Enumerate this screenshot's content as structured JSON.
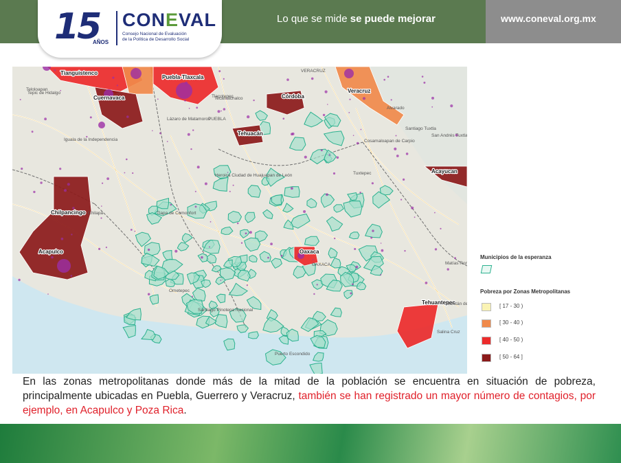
{
  "header": {
    "tagline_prefix": "Lo que se mide ",
    "tagline_bold": "se puede mejorar",
    "url": "www.coneval.org.mx",
    "colors": {
      "bar": "#5b7a50",
      "url_bar": "#8d8d8d"
    }
  },
  "logo": {
    "anniversary": "15",
    "anniversary_suffix": "AÑOS",
    "name_part1": "CON",
    "name_accent": "E",
    "name_part2": "VAL",
    "subtitle_line1": "Consejo Nacional de Evaluación",
    "subtitle_line2": "de la Política de Desarrollo Social"
  },
  "map": {
    "labels": [
      "Tianguistenco",
      "Puebla-Tlaxcala",
      "Veracruz",
      "Cuernavaca",
      "Tehuacán",
      "Córdoba",
      "Tlacotepec",
      "Teloloapan",
      "Chilpancingo",
      "Acapulco",
      "Oaxaca",
      "OAXACA",
      "Tehuantepec",
      "Acayucan",
      "Alvarado",
      "Santiago Tuxtla",
      "Cosamaloapan de Carpio",
      "San Andrés Tuxtla",
      "Iguala de la Independencia",
      "Heroica Ciudad de Huajuapan de León",
      "Tlapa de Comonfort",
      "Ometepec",
      "Santiago Pinotepa Nacional",
      "Puerto Escondido",
      "Juchitán de Zaragoza",
      "Salina Cruz",
      "Matías Romero",
      "Tuxtepec",
      "PUEBLA",
      "VERACRUZ",
      "Tepic de Hidalgo",
      "Lázaro de Matamoros",
      "Chilapa",
      "Tecamachalco"
    ],
    "colors": {
      "land": "#e8e7df",
      "ocean": "#cfe7f0",
      "esperanza": "#a6e0cc",
      "esperanza_outline": "#2bb18f",
      "points": "#9b2ea6"
    }
  },
  "legend": {
    "title_esperanza": "Municipios de la esperanza",
    "title_pobreza": "Pobreza por Zonas Metropolitanas",
    "items": [
      {
        "label": "[ 17 - 30 )",
        "color": "#faf3b4"
      },
      {
        "label": "[ 30 - 40 )",
        "color": "#f08a4b"
      },
      {
        "label": "[ 40 - 50 )",
        "color": "#ec2b2b"
      },
      {
        "label": "[ 50 - 64 ]",
        "color": "#8b1a1a"
      }
    ]
  },
  "caption": {
    "black": "En las zonas metropolitanas donde más de la mitad de la población se encuentra en situación de pobreza, principalmente ubicadas en Puebla, Guerrero y Veracruz, ",
    "red": "también se han registrado un mayor número de contagios, por ejemplo, en Acapulco y Poza Rica",
    "end": "."
  }
}
